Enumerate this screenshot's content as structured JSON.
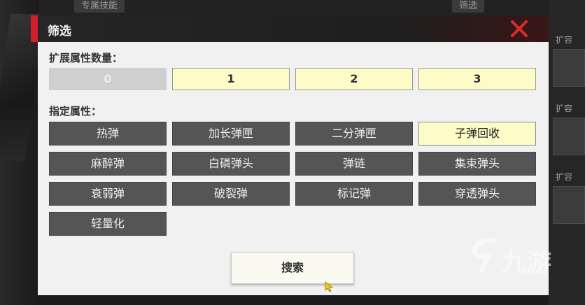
{
  "background": {
    "top_tabs": [
      "专属技能",
      "筛选"
    ],
    "right_labels": [
      "扩容",
      "扩容",
      "扩容"
    ]
  },
  "dialog": {
    "title": "筛选",
    "close_icon": "close-x-icon",
    "expand_count_label": "扩展属性数量：",
    "count_options": [
      {
        "label": "0",
        "state": "disabled"
      },
      {
        "label": "1",
        "state": "normal"
      },
      {
        "label": "2",
        "state": "normal"
      },
      {
        "label": "3",
        "state": "normal"
      }
    ],
    "attr_label": "指定属性：",
    "attributes": [
      {
        "label": "热弹",
        "selected": false
      },
      {
        "label": "加长弹匣",
        "selected": false
      },
      {
        "label": "二分弹匣",
        "selected": false
      },
      {
        "label": "子弹回收",
        "selected": true
      },
      {
        "label": "麻醉弹",
        "selected": false
      },
      {
        "label": "白磷弹头",
        "selected": false
      },
      {
        "label": "弹链",
        "selected": false
      },
      {
        "label": "集束弹头",
        "selected": false
      },
      {
        "label": "衰弱弹",
        "selected": false
      },
      {
        "label": "破裂弹",
        "selected": false
      },
      {
        "label": "标记弹",
        "selected": false
      },
      {
        "label": "穿透弹头",
        "selected": false
      },
      {
        "label": "轻量化",
        "selected": false
      }
    ],
    "search_label": "搜索"
  },
  "watermark": {
    "text": "九游",
    "icon": "jiuyou-logo-icon"
  },
  "colors": {
    "accent": "#d41f2a",
    "selected": "#fdfcc8",
    "attr_bg": "#555555",
    "dialog_bg": "#f1f1f1"
  }
}
